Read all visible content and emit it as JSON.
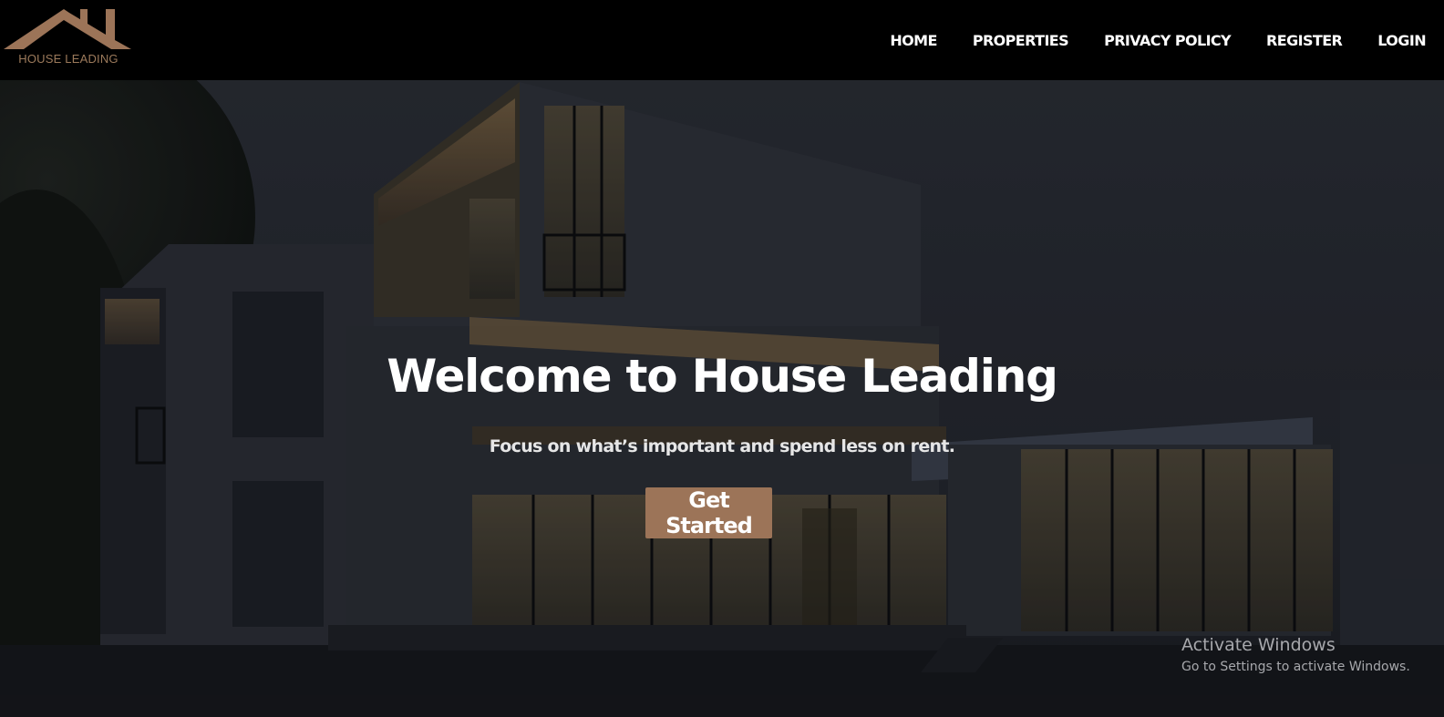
{
  "brand": {
    "name": "HOUSE LEADING",
    "logo_icon": "house-roof-icon",
    "accent_color": "#9c7458"
  },
  "nav": {
    "items": [
      {
        "label": "HOME"
      },
      {
        "label": "PROPERTIES"
      },
      {
        "label": "PRIVACY POLICY"
      },
      {
        "label": "REGISTER"
      },
      {
        "label": "LOGIN"
      }
    ]
  },
  "hero": {
    "title": "Welcome to House Leading",
    "subtitle": "Focus on what’s important and spend less on rent.",
    "cta_label": "Get Started",
    "background": "modern-house-night-photo"
  },
  "watermark": {
    "title": "Activate Windows",
    "subtitle": "Go to Settings to activate Windows."
  }
}
